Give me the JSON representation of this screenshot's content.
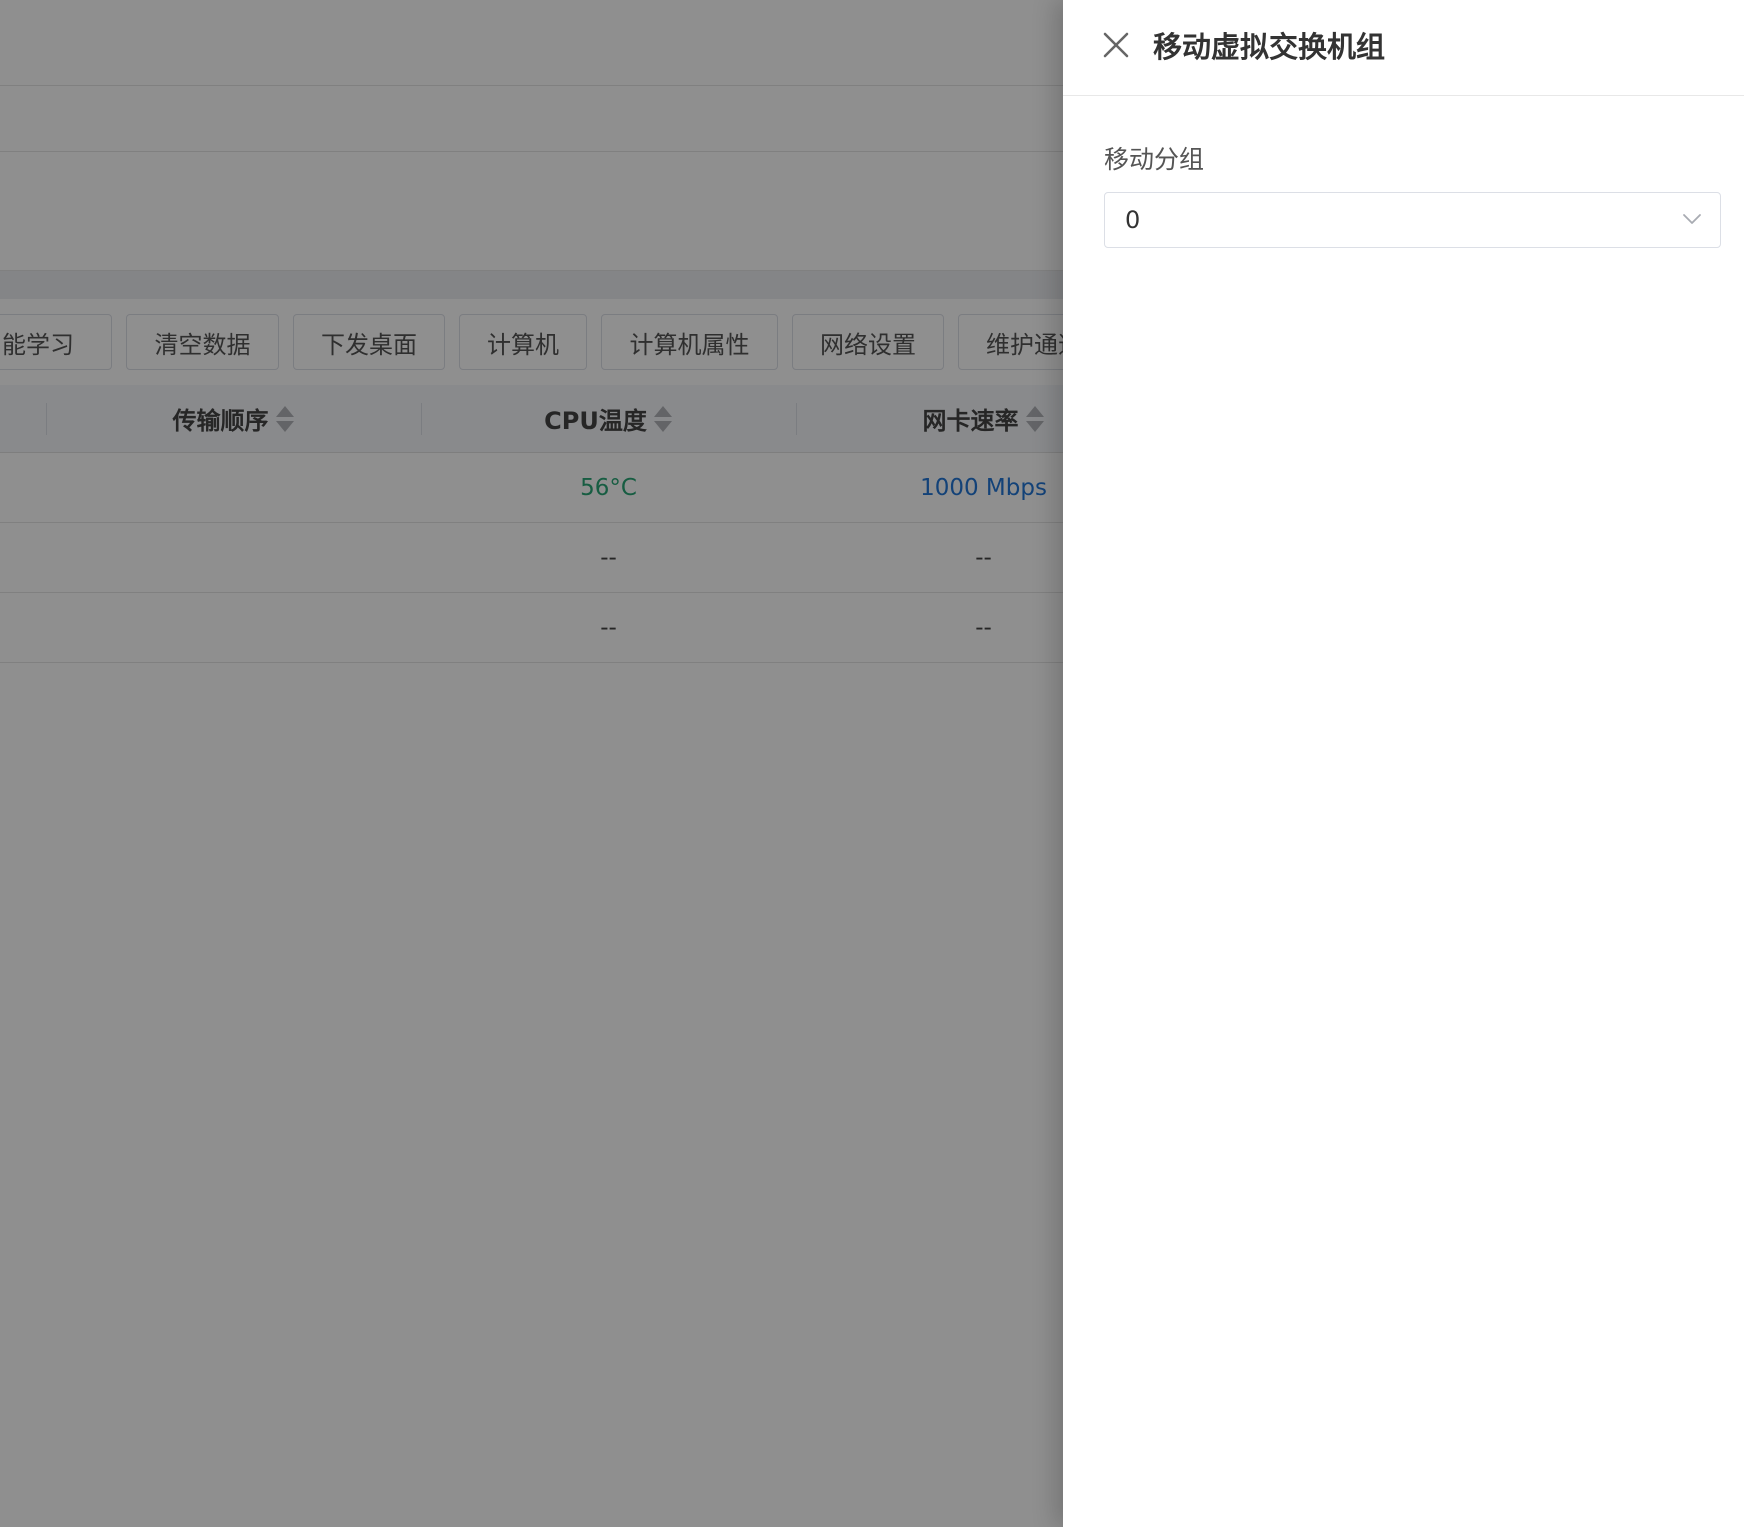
{
  "toolbar": {
    "buttons": [
      "智能学习",
      "清空数据",
      "下发桌面",
      "计算机",
      "计算机属性",
      "网络设置",
      "维护通道"
    ]
  },
  "table": {
    "headers": [
      "传输顺序",
      "CPU温度",
      "网卡速率"
    ],
    "rows": [
      {
        "cpu_temp": "56°C",
        "nic_speed": "1000 Mbps"
      },
      {
        "cpu_temp": "--",
        "nic_speed": "--"
      },
      {
        "cpu_temp": "--",
        "nic_speed": "--"
      }
    ]
  },
  "colors": {
    "temp_ok": "#2aa676",
    "speed_link": "#2276d6"
  },
  "drawer": {
    "title": "移动虚拟交换机组",
    "close_icon": "close-icon",
    "field_label": "移动分组",
    "select": {
      "value": "0",
      "arrow_icon": "chevron-down-icon"
    }
  }
}
